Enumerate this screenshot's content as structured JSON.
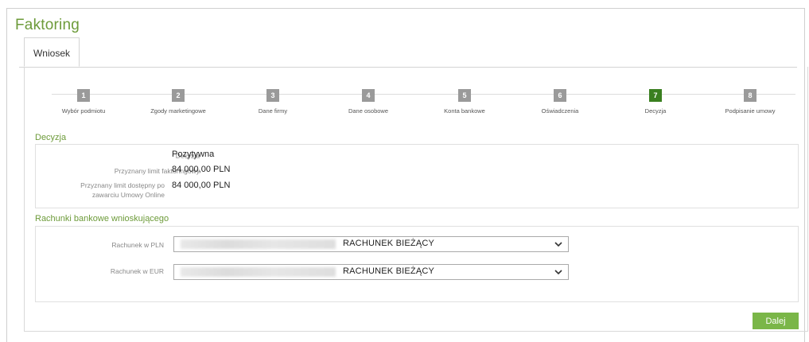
{
  "page": {
    "title": "Faktoring"
  },
  "tabs": [
    {
      "label": "Wniosek"
    }
  ],
  "steps": [
    {
      "num": "1",
      "label": "Wybór podmiotu"
    },
    {
      "num": "2",
      "label": "Zgody marketingowe"
    },
    {
      "num": "3",
      "label": "Dane firmy"
    },
    {
      "num": "4",
      "label": "Dane osobowe"
    },
    {
      "num": "5",
      "label": "Konta bankowe"
    },
    {
      "num": "6",
      "label": "Oświadczenia"
    },
    {
      "num": "7",
      "label": "Decyzja"
    },
    {
      "num": "8",
      "label": "Podpisanie umowy"
    }
  ],
  "active_step": 7,
  "decision": {
    "title": "Decyzja",
    "decision_label": "Decyzja",
    "decision_value": "Pozytywna",
    "limit_label": "Przyznany limit faktoringowy",
    "limit_value": "84 000,00 PLN",
    "available_label": "Przyznany limit dostępny po zawarciu Umowy Online",
    "available_value": "84 000,00 PLN"
  },
  "accounts": {
    "title": "Rachunki bankowe wnioskującego",
    "pln_label": "Rachunek w PLN",
    "pln_value": "RACHUNEK BIEŻĄCY",
    "eur_label": "Rachunek w EUR",
    "eur_value": "RACHUNEK BIEŻĄCY"
  },
  "buttons": {
    "next": "Dalej"
  },
  "colors": {
    "accent": "#6d9b3a",
    "active_step": "#3a7f20",
    "inactive_step": "#9a9a9a",
    "button": "#7ab648"
  }
}
